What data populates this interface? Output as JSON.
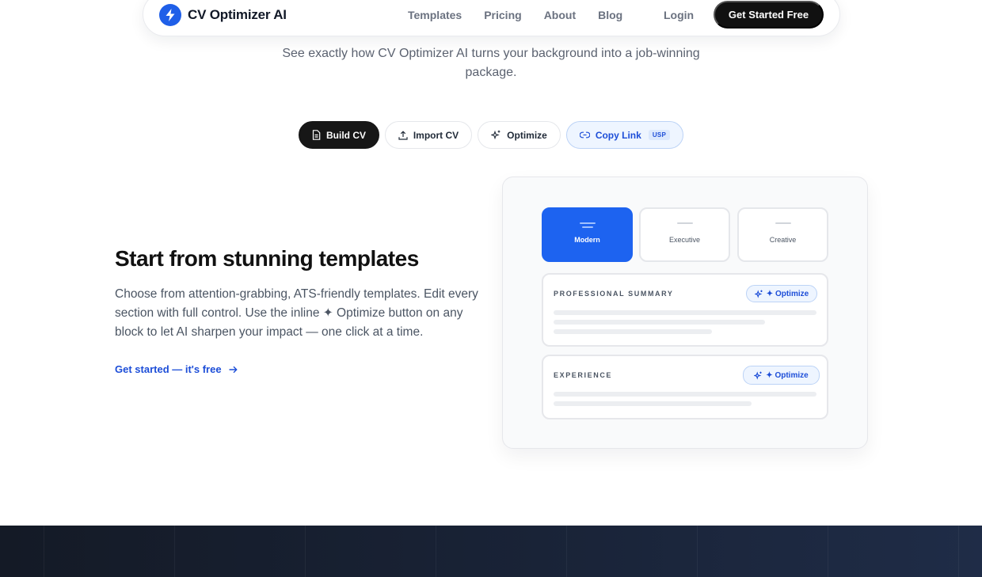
{
  "brand": {
    "name": "CV Optimizer AI",
    "accent": "#1f5fe8",
    "logo_icon": "lightning-bolt-icon"
  },
  "nav": {
    "links": [
      "Templates",
      "Pricing",
      "About",
      "Blog"
    ],
    "login": "Login",
    "cta": "Get Started Free"
  },
  "hero": {
    "subtitle": "See exactly how CV Optimizer AI turns your background into a job-winning package."
  },
  "tabs": [
    {
      "label": "Build CV",
      "icon": "document-icon",
      "active": true
    },
    {
      "label": "Import CV",
      "icon": "upload-icon",
      "active": false
    },
    {
      "label": "Optimize",
      "icon": "sparkles-icon",
      "active": false
    },
    {
      "label": "Copy Link",
      "icon": "link-icon",
      "active": false,
      "badge": "USP"
    }
  ],
  "feature": {
    "title": "Start from stunning templates",
    "description": "Choose from attention-grabbing, ATS-friendly templates. Edit every section with full control. Use the inline ✦ Optimize button on any block to let AI sharpen your impact — one click at a time.",
    "link": "Get started — it's free"
  },
  "preview": {
    "templates": [
      {
        "label": "Modern",
        "selected": true
      },
      {
        "label": "Executive",
        "selected": false
      },
      {
        "label": "Creative",
        "selected": false
      }
    ],
    "sections": [
      {
        "label": "PROFESSIONAL SUMMARY",
        "button": "✦ Optimize"
      },
      {
        "label": "EXPERIENCE",
        "button": "✦ Optimize"
      }
    ]
  },
  "colors": {
    "primary": "#1d63f0",
    "dark": "#111111",
    "link": "#1d4ed8",
    "footer": "#192337"
  }
}
